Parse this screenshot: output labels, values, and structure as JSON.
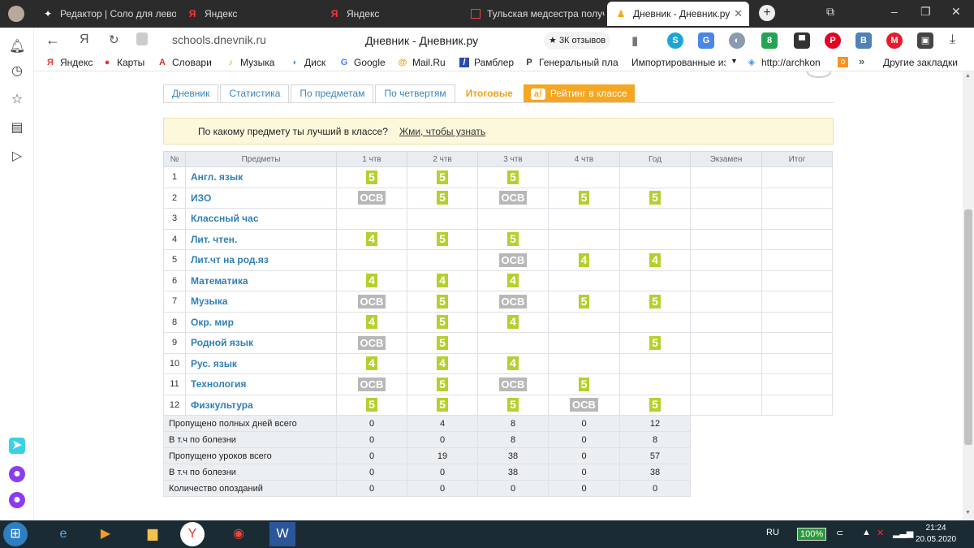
{
  "browser": {
    "tabs": [
      {
        "label": "Редактор | Соло для лево",
        "icon": "plus-star-icon"
      },
      {
        "label": "Яндекс",
        "icon": "yandex-icon"
      },
      {
        "label": "Яндекс",
        "icon": "yandex-icon"
      },
      {
        "label": "Тульская медсестра получ",
        "icon": "news-icon"
      },
      {
        "label": "Дневник - Дневник.ру",
        "icon": "dnevnik-icon",
        "active": true
      }
    ],
    "url": "schools.dnevnik.ru",
    "page_title": "Дневник - Дневник.ру",
    "reviews": "3К отзывов",
    "bookmarks": [
      "Яндекс",
      "Карты",
      "Словари",
      "Музыка",
      "Диск",
      "Google",
      "Mail.Ru",
      "Рамблер",
      "Генеральный пла",
      "Импортированные из",
      "http://archkon",
      "Другие закладки"
    ]
  },
  "nav_tabs": [
    "Дневник",
    "Статистика",
    "По предметам",
    "По четвертям",
    "Итоговые",
    "Рейтинг в классе"
  ],
  "banner": {
    "question": "По какому предмету ты лучший в классе?",
    "link": "Жми, чтобы узнать"
  },
  "table": {
    "headers": [
      "№",
      "Предметы",
      "1 чтв",
      "2 чтв",
      "3 чтв",
      "4 чтв",
      "Год",
      "Экзамен",
      "Итог"
    ],
    "rows": [
      {
        "n": "1",
        "subject": "Англ. язык",
        "marks": [
          "5",
          "5",
          "5",
          "",
          "",
          "",
          ""
        ]
      },
      {
        "n": "2",
        "subject": "ИЗО",
        "marks": [
          "ОСВ",
          "5",
          "ОСВ",
          "5",
          "5",
          "",
          ""
        ]
      },
      {
        "n": "3",
        "subject": "Классный час",
        "marks": [
          "",
          "",
          "",
          "",
          "",
          "",
          ""
        ]
      },
      {
        "n": "4",
        "subject": "Лит. чтен.",
        "marks": [
          "4",
          "5",
          "5",
          "",
          "",
          "",
          ""
        ]
      },
      {
        "n": "5",
        "subject": "Лит.чт на род.яз",
        "marks": [
          "",
          "",
          "ОСВ",
          "4",
          "4",
          "",
          ""
        ]
      },
      {
        "n": "6",
        "subject": "Математика",
        "marks": [
          "4",
          "4",
          "4",
          "",
          "",
          "",
          ""
        ]
      },
      {
        "n": "7",
        "subject": "Музыка",
        "marks": [
          "ОСВ",
          "5",
          "ОСВ",
          "5",
          "5",
          "",
          ""
        ]
      },
      {
        "n": "8",
        "subject": "Окр. мир",
        "marks": [
          "4",
          "5",
          "4",
          "",
          "",
          "",
          ""
        ]
      },
      {
        "n": "9",
        "subject": "Родной язык",
        "marks": [
          "ОСВ",
          "5",
          "",
          "",
          "5",
          "",
          ""
        ]
      },
      {
        "n": "10",
        "subject": "Рус. язык",
        "marks": [
          "4",
          "4",
          "4",
          "",
          "",
          "",
          ""
        ]
      },
      {
        "n": "11",
        "subject": "Технология",
        "marks": [
          "ОСВ",
          "5",
          "ОСВ",
          "5",
          "",
          "",
          ""
        ]
      },
      {
        "n": "12",
        "subject": "Физкультура",
        "marks": [
          "5",
          "5",
          "5",
          "ОСВ",
          "5",
          "",
          ""
        ]
      }
    ],
    "stats": [
      {
        "label": "Пропущено полных дней всего",
        "values": [
          "0",
          "4",
          "8",
          "0",
          "12"
        ]
      },
      {
        "label": "В т.ч по болезни",
        "values": [
          "0",
          "0",
          "8",
          "0",
          "8"
        ]
      },
      {
        "label": "Пропущено уроков всего",
        "values": [
          "0",
          "19",
          "38",
          "0",
          "57"
        ]
      },
      {
        "label": "В т.ч по болезни",
        "values": [
          "0",
          "0",
          "38",
          "0",
          "38"
        ]
      },
      {
        "label": "Количество опозданий",
        "values": [
          "0",
          "0",
          "0",
          "0",
          "0"
        ]
      }
    ]
  },
  "taskbar": {
    "lang": "RU",
    "battery": "100%",
    "time": "21:24",
    "date": "20.05.2020"
  },
  "colors": {
    "grade": "#b6cf2e",
    "osv": "#b8b8b8",
    "link": "#2f7fb8",
    "accent": "#f5a623"
  }
}
